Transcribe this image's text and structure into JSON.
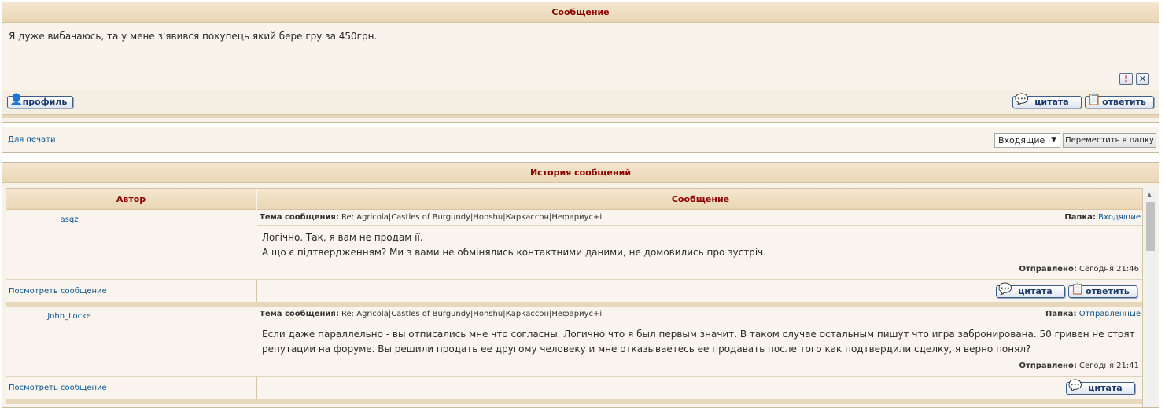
{
  "message_panel": {
    "title": "Сообщение",
    "body": "Я дуже вибачаюсь, та у мене з'явився покупець який бере гру за 450грн.",
    "buttons": {
      "profile": "профиль",
      "quote": "цитата",
      "reply": "ответить"
    },
    "icons": {
      "report": "!",
      "delete": "✕"
    }
  },
  "print_bar": {
    "print_link": "Для печати",
    "folder_select_value": "Входящие",
    "move_button": "Переместить в папку"
  },
  "history": {
    "title": "История сообщений",
    "columns": {
      "author": "Автор",
      "message": "Сообщение"
    },
    "subject_label": "Тема сообщения:",
    "folder_label": "Папка:",
    "sent_label": "Отправлено:",
    "view_link": "Посмотреть сообщение",
    "entries": [
      {
        "author": "asqz",
        "subject": "Re: Agricola|Castles of Burgundy|Honshu|Каркассон|Нефариус+і",
        "folder": "Входящие",
        "lines": [
          "Логічно. Так, я вам не продам її.",
          "А що є підтвердженням? Ми з вами не обмінялись контактними даними, не домовились про зустріч."
        ],
        "sent": "Сегодня 21:46",
        "quote": "цитата",
        "reply": "ответить"
      },
      {
        "author": "John_Locke",
        "subject": "Re: Agricola|Castles of Burgundy|Honshu|Каркассон|Нефариус+і",
        "folder": "Отправленные",
        "lines": [
          "Если даже параллельно - вы отписались мне что согласны. Логично что я был первым значит. В таком случае остальным пишут что игра забронирована. 50 гривен не стоят",
          "репутации на форуме. Вы решили продать ее другому человеку и мне отказываетесь ее продавать после того как подтвердили сделку, я верно понял?"
        ],
        "sent": "Сегодня 21:41",
        "quote": "цитата"
      }
    ]
  }
}
